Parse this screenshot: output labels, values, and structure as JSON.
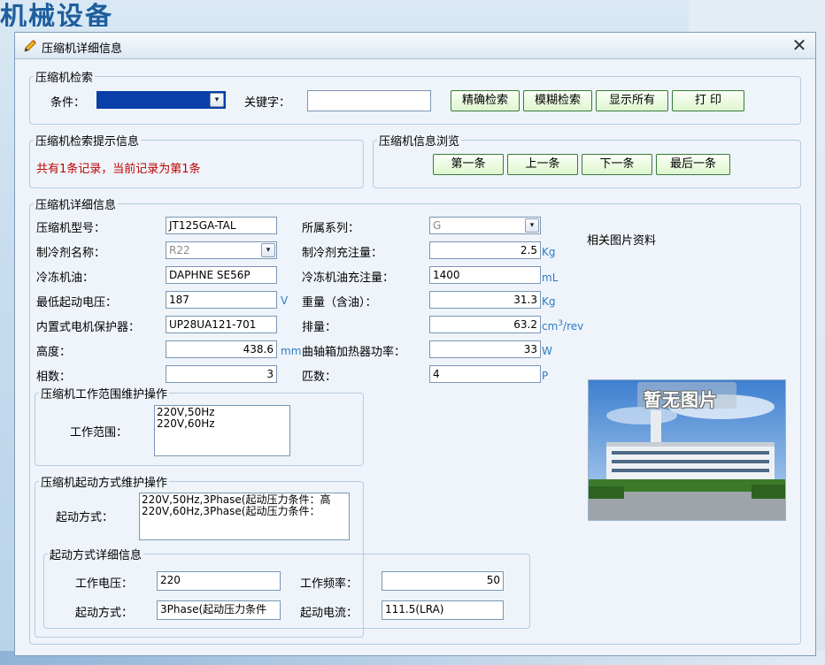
{
  "background": {
    "logo_text": "机械设备"
  },
  "window": {
    "title": "压缩机详细信息",
    "close_symbol": "✕"
  },
  "search": {
    "legend": "压缩机检索",
    "condition_label": "条件：",
    "condition_value": "",
    "keyword_label": "关键字：",
    "keyword_value": "",
    "buttons": {
      "exact": "精确检索",
      "fuzzy": "模糊检索",
      "show_all": "显示所有",
      "print": "打 印"
    }
  },
  "hint": {
    "legend": "压缩机检索提示信息",
    "message": "共有1条记录，当前记录为第1条"
  },
  "browse": {
    "legend": "压缩机信息浏览",
    "buttons": {
      "first": "第一条",
      "prev": "上一条",
      "next": "下一条",
      "last": "最后一条"
    }
  },
  "detail": {
    "legend": "压缩机详细信息",
    "model_label": "压缩机型号：",
    "model_value": "JT125GA-TAL",
    "series_label": "所属系列：",
    "series_value": "G",
    "refrigerant_label": "制冷剂名称：",
    "refrigerant_value": "R22",
    "charge_label": "制冷剂充注量：",
    "charge_value": "2.5",
    "charge_unit": "Kg",
    "oil_label": "冷冻机油：",
    "oil_value": "DAPHNE SE56P",
    "oil_charge_label": "冷冻机油充注量：",
    "oil_charge_value": "1400",
    "oil_charge_unit": "mL",
    "min_voltage_label": "最低起动电压：",
    "min_voltage_value": "187",
    "min_voltage_unit": "V",
    "weight_label": "重量（含油）：",
    "weight_value": "31.3",
    "weight_unit": "Kg",
    "protector_label": "内置式电机保护器：",
    "protector_value": "UP28UA121-701",
    "displacement_label": "排量：",
    "displacement_value": "63.2",
    "displacement_unit_main": "cm",
    "displacement_unit_sup": "3",
    "displacement_unit_rest": "/rev",
    "height_label": "高度：",
    "height_value": "438.6",
    "height_unit": "mm",
    "heater_label": "曲轴箱加热器功率：",
    "heater_value": "33",
    "heater_unit": "W",
    "phase_label": "相数：",
    "phase_value": "3",
    "poles_label": "匹数：",
    "poles_value": "4",
    "poles_unit": "P",
    "image_label": "相关图片资料",
    "image_overlay": "暂无图片"
  },
  "work_range": {
    "legend": "压缩机工作范围维护操作",
    "label": "工作范围：",
    "items": [
      "220V,50Hz",
      "220V,60Hz"
    ]
  },
  "start_mode": {
    "legend": "压缩机起动方式维护操作",
    "label": "起动方式：",
    "items": [
      "220V,50Hz,3Phase(起动压力条件：高",
      "220V,60Hz,3Phase(起动压力条件："
    ]
  },
  "start_detail": {
    "legend": "起动方式详细信息",
    "voltage_label": "工作电压：",
    "voltage_value": "220",
    "frequency_label": "工作频率：",
    "frequency_value": "50",
    "mode_label": "起动方式：",
    "mode_value": "3Phase(起动压力条件",
    "current_label": "起动电流：",
    "current_value": "111.5(LRA)"
  },
  "colors": {
    "accent_green": "#def6cf",
    "message_red": "#c00000",
    "unit_blue": "#2d7bc4"
  }
}
